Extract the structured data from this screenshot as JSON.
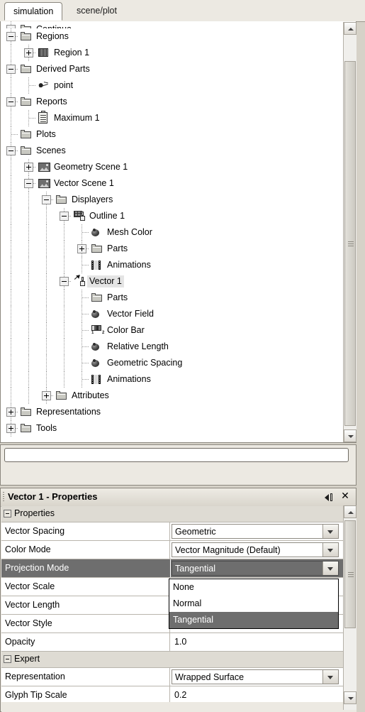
{
  "tabs": [
    {
      "label": "simulation",
      "active": true
    },
    {
      "label": "scene/plot",
      "active": false
    }
  ],
  "tree": {
    "nodes": [
      {
        "label": "Continua",
        "icon": "folder-icon",
        "depth": 0,
        "expander": "minus",
        "cut": true
      },
      {
        "label": "Regions",
        "icon": "folder-icon",
        "depth": 0,
        "expander": "minus"
      },
      {
        "label": "Region 1",
        "icon": "region-icon",
        "depth": 1,
        "expander": "plus"
      },
      {
        "label": "Derived Parts",
        "icon": "folder-icon",
        "depth": 0,
        "expander": "minus"
      },
      {
        "label": "point",
        "icon": "point-icon",
        "depth": 1,
        "expander": "none"
      },
      {
        "label": "Reports",
        "icon": "folder-icon",
        "depth": 0,
        "expander": "minus"
      },
      {
        "label": "Maximum 1",
        "icon": "report-icon",
        "depth": 1,
        "expander": "none"
      },
      {
        "label": "Plots",
        "icon": "folder-icon",
        "depth": 0,
        "expander": "none"
      },
      {
        "label": "Scenes",
        "icon": "folder-icon",
        "depth": 0,
        "expander": "minus"
      },
      {
        "label": "Geometry Scene 1",
        "icon": "scene-icon",
        "depth": 1,
        "expander": "plus"
      },
      {
        "label": "Vector Scene 1",
        "icon": "scene-icon",
        "depth": 1,
        "expander": "minus"
      },
      {
        "label": "Displayers",
        "icon": "folder-icon",
        "depth": 2,
        "expander": "minus"
      },
      {
        "label": "Outline 1",
        "icon": "displayer-icon",
        "depth": 3,
        "expander": "minus"
      },
      {
        "label": "Mesh Color",
        "icon": "node-icon",
        "depth": 4,
        "expander": "none"
      },
      {
        "label": "Parts",
        "icon": "folder-icon",
        "depth": 4,
        "expander": "plus"
      },
      {
        "label": "Animations",
        "icon": "film-icon",
        "depth": 4,
        "expander": "none"
      },
      {
        "label": "Vector 1",
        "icon": "vector-displayer-icon",
        "depth": 3,
        "expander": "minus",
        "selected": true
      },
      {
        "label": "Parts",
        "icon": "folder-icon",
        "depth": 4,
        "expander": "none"
      },
      {
        "label": "Vector Field",
        "icon": "node-icon",
        "depth": 4,
        "expander": "none"
      },
      {
        "label": "Color Bar",
        "icon": "color-bar-icon",
        "depth": 4,
        "expander": "none"
      },
      {
        "label": "Relative Length",
        "icon": "node-icon",
        "depth": 4,
        "expander": "none"
      },
      {
        "label": "Geometric Spacing",
        "icon": "node-icon",
        "depth": 4,
        "expander": "none"
      },
      {
        "label": "Animations",
        "icon": "film-icon",
        "depth": 4,
        "expander": "none"
      },
      {
        "label": "Attributes",
        "icon": "folder-icon",
        "depth": 2,
        "expander": "plus"
      },
      {
        "label": "Representations",
        "icon": "folder-icon",
        "depth": 0,
        "expander": "plus"
      },
      {
        "label": "Tools",
        "icon": "folder-icon",
        "depth": 0,
        "expander": "plus"
      }
    ]
  },
  "filter": {
    "value": "",
    "placeholder": ""
  },
  "properties_panel": {
    "title": "Vector 1 - Properties",
    "undock_icon": "undock-icon",
    "close_icon": "close-icon",
    "groups": [
      {
        "label": "Properties",
        "rows": [
          {
            "name": "Vector Spacing",
            "value": "Geometric",
            "editor": "combo"
          },
          {
            "name": "Color Mode",
            "value": "Vector Magnitude (Default)",
            "editor": "combo"
          },
          {
            "name": "Projection Mode",
            "value": "Tangential",
            "editor": "combo",
            "selected": true
          },
          {
            "name": "Vector Scale",
            "value": "",
            "editor": "text"
          },
          {
            "name": "Vector Length",
            "value": "",
            "editor": "text"
          },
          {
            "name": "Vector Style",
            "value": "",
            "editor": "text"
          },
          {
            "name": "Opacity",
            "value": "1.0",
            "editor": "text"
          }
        ]
      },
      {
        "label": "Expert",
        "rows": [
          {
            "name": "Representation",
            "value": "Wrapped Surface",
            "editor": "combo"
          },
          {
            "name": "Glyph Tip Scale",
            "value": "0.2",
            "editor": "text"
          }
        ]
      }
    ],
    "open_dropdown": {
      "field": "Projection Mode",
      "options": [
        "None",
        "Normal",
        "Tangential"
      ],
      "selected": "Tangential"
    }
  },
  "scrollbars": {
    "tree": {
      "up_icon": "chevron-up-icon",
      "down_icon": "chevron-down-icon"
    },
    "properties": {
      "up_icon": "chevron-up-icon",
      "down_icon": "chevron-down-icon"
    }
  }
}
